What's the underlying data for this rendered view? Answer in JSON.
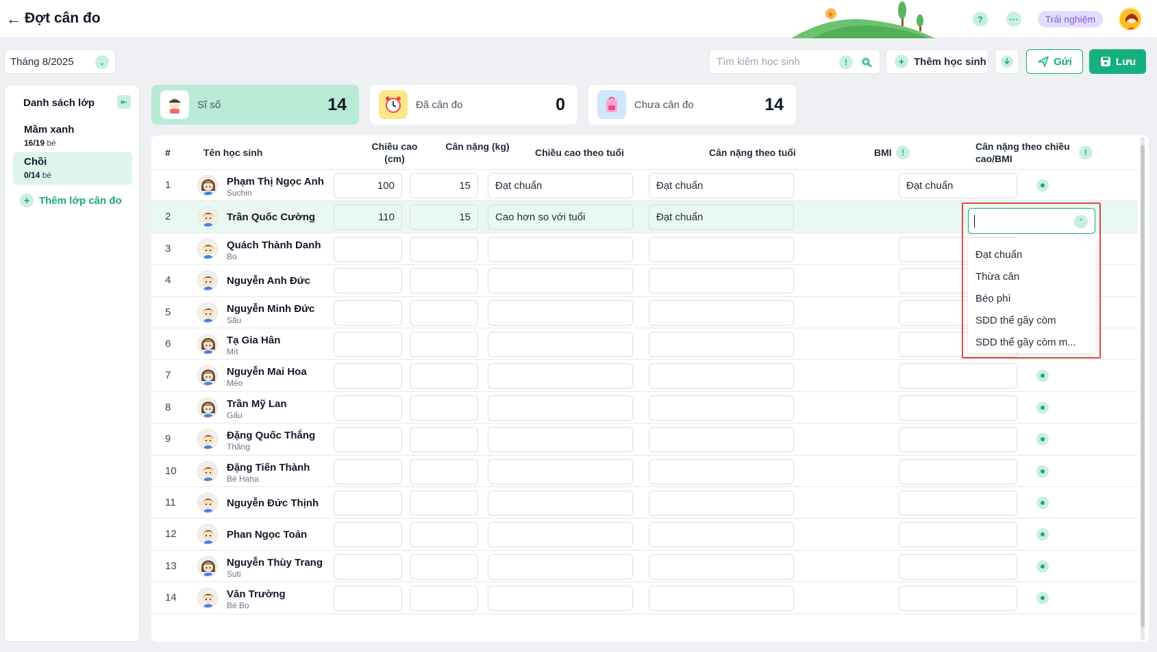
{
  "header": {
    "title": "Đợt cân đo",
    "trial_label": "Trải nghiệm"
  },
  "toolbar": {
    "month_value": "Tháng 8/2025",
    "search_placeholder": "Tìm kiếm học sinh",
    "add_student_label": "Thêm học sinh",
    "send_label": "Gửi",
    "save_label": "Lưu"
  },
  "sidebar": {
    "title": "Danh sách lớp",
    "classes": [
      {
        "name": "Mầm xanh",
        "count": "16/19",
        "unit": "bé"
      },
      {
        "name": "Chồi",
        "count": "0/14",
        "unit": "bé"
      }
    ],
    "add_class_label": "Thêm lớp cân đo"
  },
  "stats": [
    {
      "label": "Sĩ số",
      "value": "14"
    },
    {
      "label": "Đã cân đo",
      "value": "0"
    },
    {
      "label": "Chưa cân đo",
      "value": "14"
    }
  ],
  "table": {
    "headers": {
      "num": "#",
      "name": "Tên học sinh",
      "height": "Chiều cao (cm)",
      "weight": "Cân nặng (kg)",
      "height_age": "Chiều cao theo tuổi",
      "weight_age": "Cân nặng theo tuổi",
      "bmi": "BMI",
      "weight_height": "Cân nặng theo chiều cao/BMI"
    },
    "rows": [
      {
        "num": "1",
        "name": "Phạm Thị Ngọc Anh",
        "nick": "Suchin",
        "height": "100",
        "weight": "15",
        "height_age": "Đạt chuẩn",
        "weight_age": "Đạt chuẩn",
        "weight_height": "Đạt chuẩn"
      },
      {
        "num": "2",
        "name": "Trần Quốc Cường",
        "nick": "",
        "height": "110",
        "weight": "15",
        "height_age": "Cao hơn so với tuổi",
        "weight_age": "Đạt chuẩn",
        "weight_height": ""
      },
      {
        "num": "3",
        "name": "Quách Thành Danh",
        "nick": "Bo",
        "height": "",
        "weight": "",
        "height_age": "",
        "weight_age": "",
        "weight_height": ""
      },
      {
        "num": "4",
        "name": "Nguyễn Anh Đức",
        "nick": "",
        "height": "",
        "weight": "",
        "height_age": "",
        "weight_age": "",
        "weight_height": ""
      },
      {
        "num": "5",
        "name": "Nguyễn Minh Đức",
        "nick": "Sâu",
        "height": "",
        "weight": "",
        "height_age": "",
        "weight_age": "",
        "weight_height": ""
      },
      {
        "num": "6",
        "name": "Tạ Gia Hân",
        "nick": "Mít",
        "height": "",
        "weight": "",
        "height_age": "",
        "weight_age": "",
        "weight_height": ""
      },
      {
        "num": "7",
        "name": "Nguyễn Mai Hoa",
        "nick": "Mèo",
        "height": "",
        "weight": "",
        "height_age": "",
        "weight_age": "",
        "weight_height": ""
      },
      {
        "num": "8",
        "name": "Trần Mỹ Lan",
        "nick": "Gấu",
        "height": "",
        "weight": "",
        "height_age": "",
        "weight_age": "",
        "weight_height": ""
      },
      {
        "num": "9",
        "name": "Đặng Quốc Thắng",
        "nick": "Thắng",
        "height": "",
        "weight": "",
        "height_age": "",
        "weight_age": "",
        "weight_height": ""
      },
      {
        "num": "10",
        "name": "Đặng Tiến Thành",
        "nick": "Bé Haha",
        "height": "",
        "weight": "",
        "height_age": "",
        "weight_age": "",
        "weight_height": ""
      },
      {
        "num": "11",
        "name": "Nguyễn Đức Thịnh",
        "nick": "",
        "height": "",
        "weight": "",
        "height_age": "",
        "weight_age": "",
        "weight_height": ""
      },
      {
        "num": "12",
        "name": "Phan Ngọc Toản",
        "nick": "",
        "height": "",
        "weight": "",
        "height_age": "",
        "weight_age": "",
        "weight_height": ""
      },
      {
        "num": "13",
        "name": "Nguyễn Thùy Trang",
        "nick": "Suti",
        "height": "",
        "weight": "",
        "height_age": "",
        "weight_age": "",
        "weight_height": ""
      },
      {
        "num": "14",
        "name": "Văn Trường",
        "nick": "Bé Bo",
        "height": "",
        "weight": "",
        "height_age": "",
        "weight_age": "",
        "weight_height": ""
      }
    ]
  },
  "dropdown": {
    "options": [
      "Đạt chuẩn",
      "Thừa cân",
      "Béo phì",
      "SDD thể gầy còm",
      "SDD thể gầy còm m..."
    ]
  },
  "colors": {
    "accent": "#15b07e",
    "accent_light": "#c9efe0",
    "highlight_row": "#eaf8f2",
    "dropdown_frame": "#e0463f",
    "trial_bg": "#e4dcff"
  }
}
